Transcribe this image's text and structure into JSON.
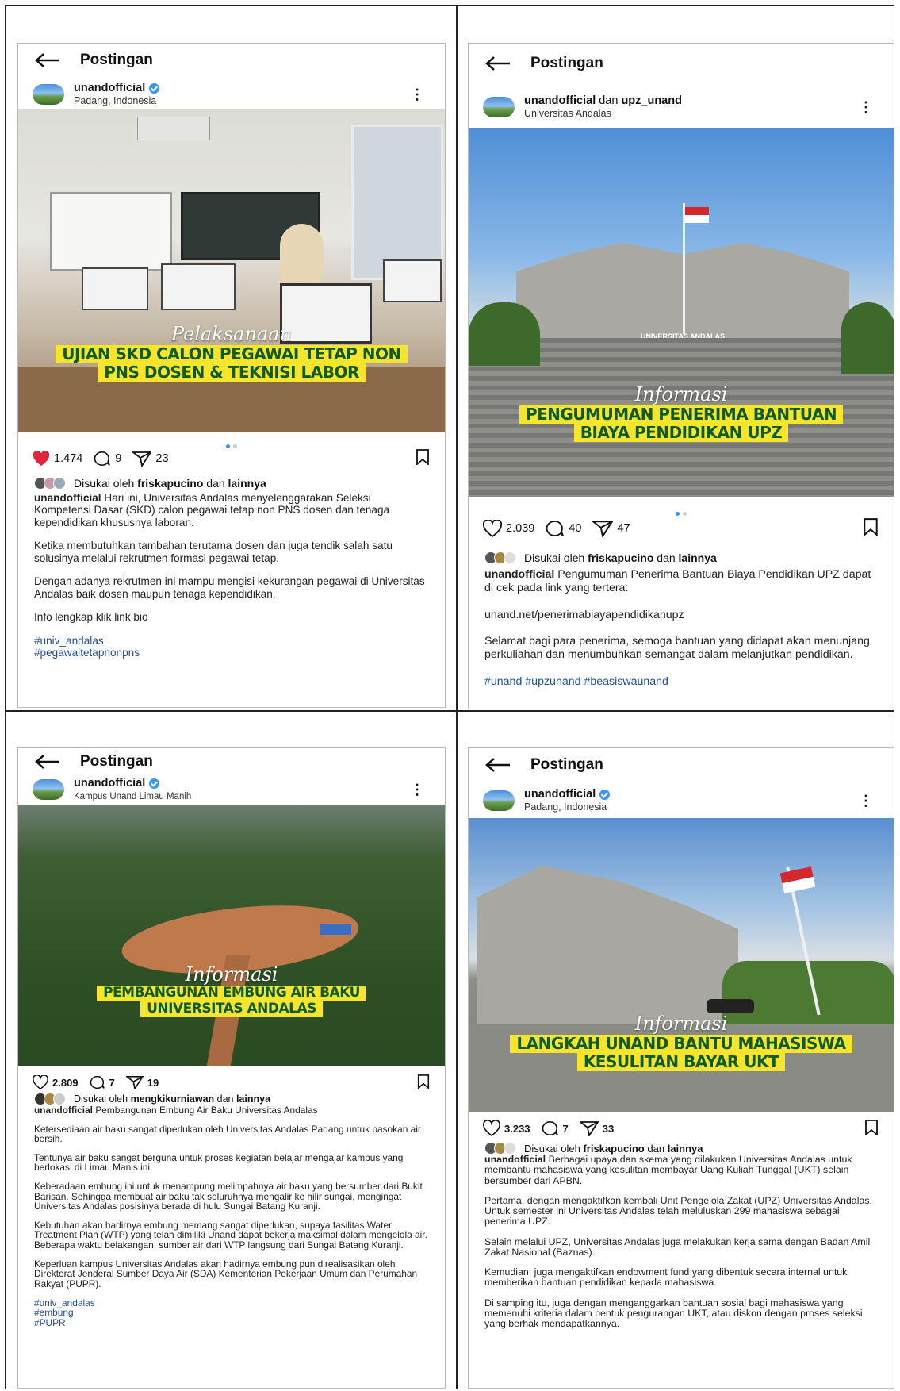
{
  "panels": [
    {
      "header_title": "Postingan",
      "account": "unandofficial",
      "account2": "",
      "location": "Padang, Indonesia",
      "banner_script": "Pelaksanaan",
      "banner_lines": [
        "UJIAN SKD CALON PEGAWAI TETAP NON",
        "PNS DOSEN & TEKNISI LABOR"
      ],
      "likes": "1.474",
      "comments": "9",
      "shares": "23",
      "liked_prefix": "Disukai oleh",
      "liked_user": "friskapucino",
      "liked_and": "dan",
      "liked_others": "lainnya",
      "caption_user": "unandofficial",
      "caption_first": "Hari ini, Universitas Andalas menyelenggarakan Seleksi Kompetensi Dasar (SKD) calon pegawai tetap non PNS dosen dan tenaga kependidikan khususnya laboran.",
      "paragraphs": [
        "Ketika membutuhkan tambahan terutama dosen dan juga tendik salah satu solusinya melalui rekrutmen formasi pegawai tetap.",
        "Dengan adanya rekrutmen ini mampu mengisi kekurangan pegawai di Universitas Andalas baik dosen maupun tenaga kependidikan.",
        "Info lengkap klik link bio"
      ],
      "hashtags": [
        "#univ_andalas",
        "#pegawaitetapnonpns"
      ]
    },
    {
      "header_title": "Postingan",
      "account": "unandofficial",
      "account2": "upz_unand",
      "account_join": "dan",
      "location": "Universitas Andalas",
      "banner_script": "Informasi",
      "banner_lines": [
        "PENGUMUMAN PENERIMA BANTUAN",
        "BIAYA PENDIDIKAN UPZ"
      ],
      "building_sign": "UNIVERSITAS ANDALAS",
      "likes": "2.039",
      "comments": "40",
      "shares": "47",
      "liked_prefix": "Disukai oleh",
      "liked_user": "friskapucino",
      "liked_and": "dan",
      "liked_others": "lainnya",
      "caption_user": "unandofficial",
      "caption_first": "Pengumuman Penerima Bantuan Biaya Pendidikan UPZ dapat di cek pada link yang tertera:",
      "paragraphs": [
        "unand.net/penerimabiayapendidikanupz",
        "Selamat bagi para penerima, semoga bantuan yang didapat akan menunjang perkuliahan dan menumbuhkan semangat dalam melanjutkan pendidikan."
      ],
      "hashtags": [
        "#unand #upzunand #beasiswaunand"
      ]
    },
    {
      "header_title": "Postingan",
      "account": "unandofficial",
      "account2": "",
      "location": "Kampus Unand Limau Manih",
      "banner_script": "Informasi",
      "banner_lines": [
        "PEMBANGUNAN EMBUNG AIR BAKU",
        "UNIVERSITAS ANDALAS"
      ],
      "likes": "2.809",
      "comments": "7",
      "shares": "19",
      "liked_prefix": "Disukai oleh",
      "liked_user": "mengkikurniawan",
      "liked_and": "dan",
      "liked_others": "lainnya",
      "caption_user": "unandofficial",
      "caption_first": "Pembangunan Embung Air Baku Universitas Andalas",
      "paragraphs": [
        "Ketersediaan air baku sangat diperlukan oleh Universitas Andalas Padang untuk pasokan air bersih.",
        "Tentunya air baku sangat berguna untuk proses kegiatan belajar mengajar kampus yang berlokasi di Limau Manis ini.",
        "Keberadaan embung ini untuk menampung melimpahnya air baku yang bersumber dari Bukit Barisan.  Sehingga membuat air baku tak seluruhnya mengalir ke hilir sungai, mengingat Universitas Andalas posisinya berada di hulu Sungai Batang Kuranji.",
        "Kebutuhan akan hadirnya embung memang sangat diperlukan, supaya fasilitas Water Treatment Plan (WTP) yang telah dimiliki Unand dapat bekerja maksimal dalam mengelola air. Beberapa waktu belakangan, sumber air dari WTP langsung dari Sungai Batang Kuranji.",
        "Keperluan kampus Universitas Andalas akan hadirnya embung pun direalisasikan oleh Direktorat Jenderal Sumber Daya Air (SDA) Kementerian Pekerjaan Umum dan Perumahan Rakyat (PUPR)."
      ],
      "hashtags": [
        "#univ_andalas",
        "#embung",
        "#PUPR"
      ]
    },
    {
      "header_title": "Postingan",
      "account": "unandofficial",
      "account2": "",
      "location": "Padang, Indonesia",
      "banner_script": "Informasi",
      "banner_lines": [
        "LANGKAH UNAND BANTU MAHASISWA",
        "KESULITAN BAYAR UKT"
      ],
      "likes": "3.233",
      "comments": "7",
      "shares": "33",
      "liked_prefix": "Disukai oleh",
      "liked_user": "friskapucino",
      "liked_and": "dan",
      "liked_others": "lainnya",
      "caption_user": "unandofficial",
      "caption_first": "Berbagai upaya dan skema yang dilakukan Universitas Andalas untuk membantu mahasiswa yang kesulitan membayar Uang Kuliah Tunggal (UKT) selain bersumber dari APBN.",
      "paragraphs": [
        "Pertama, dengan mengaktifkan kembali Unit Pengelola Zakat (UPZ) Universitas Andalas. Untuk semester ini Universitas Andalas telah meluluskan 299 mahasiswa sebagai penerima UPZ.",
        "Selain melalui UPZ, Universitas Andalas juga melakukan kerja sama dengan Badan Amil Zakat Nasional (Baznas).",
        "Kemudian, juga mengaktifkan endowment fund yang dibentuk secara internal untuk memberikan bantuan pendidikan kepada mahasiswa.",
        "Di samping itu, juga dengan menganggarkan bantuan sosial bagi mahasiswa yang memenuhi kriteria dalam bentuk pengurangan UKT, atau diskon dengan proses seleksi yang berhak mendapatkannya."
      ],
      "hashtags": []
    }
  ]
}
